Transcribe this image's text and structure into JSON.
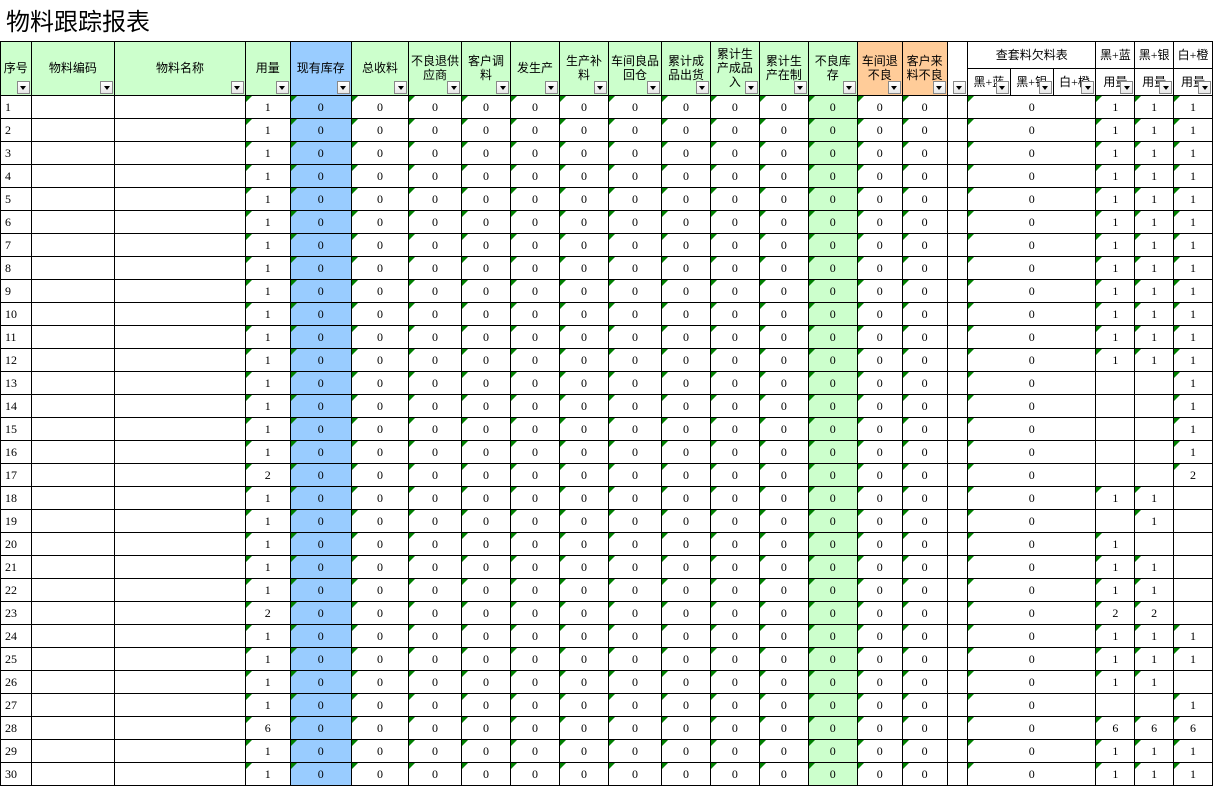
{
  "title": "物料跟踪报表",
  "headers": {
    "seq": "序号",
    "code": "物料编码",
    "name": "物料名称",
    "usage": "用量",
    "stock": "现有库存",
    "recv": "总收料",
    "defret": "不良退供应商",
    "custadj": "客户调料",
    "prod": "发生产",
    "prodsup": "生产补料",
    "wsreturn": "车间良品回仓",
    "cumout": "累计成品出货",
    "cumin": "累计生产成品入",
    "cumwip": "累计生产在制",
    "defstock": "不良库存",
    "wsdef": "车间退不良",
    "custdef": "客户来料不良",
    "gap": "",
    "kit_title": "查套料欠料表",
    "kit1": "黑+蓝",
    "kit2": "黑+银",
    "kit3": "白+橙",
    "kit4a": "黑+蓝",
    "kit4b": "用量",
    "kit5a": "黑+银",
    "kit5b": "用量",
    "kit6a": "白+橙",
    "kit6b": "用量"
  },
  "rows": [
    {
      "seq": 1,
      "usage": 1,
      "k4": 1,
      "k5": 1,
      "k6": 1
    },
    {
      "seq": 2,
      "usage": 1,
      "k4": 1,
      "k5": 1,
      "k6": 1
    },
    {
      "seq": 3,
      "usage": 1,
      "k4": 1,
      "k5": 1,
      "k6": 1
    },
    {
      "seq": 4,
      "usage": 1,
      "k4": 1,
      "k5": 1,
      "k6": 1
    },
    {
      "seq": 5,
      "usage": 1,
      "k4": 1,
      "k5": 1,
      "k6": 1
    },
    {
      "seq": 6,
      "usage": 1,
      "k4": 1,
      "k5": 1,
      "k6": 1
    },
    {
      "seq": 7,
      "usage": 1,
      "k4": 1,
      "k5": 1,
      "k6": 1
    },
    {
      "seq": 8,
      "usage": 1,
      "k4": 1,
      "k5": 1,
      "k6": 1
    },
    {
      "seq": 9,
      "usage": 1,
      "k4": 1,
      "k5": 1,
      "k6": 1
    },
    {
      "seq": 10,
      "usage": 1,
      "k4": 1,
      "k5": 1,
      "k6": 1
    },
    {
      "seq": 11,
      "usage": 1,
      "k4": 1,
      "k5": 1,
      "k6": 1
    },
    {
      "seq": 12,
      "usage": 1,
      "k4": 1,
      "k5": 1,
      "k6": 1
    },
    {
      "seq": 13,
      "usage": 1,
      "k4": "",
      "k5": "",
      "k6": 1
    },
    {
      "seq": 14,
      "usage": 1,
      "k4": "",
      "k5": "",
      "k6": 1
    },
    {
      "seq": 15,
      "usage": 1,
      "k4": "",
      "k5": "",
      "k6": 1
    },
    {
      "seq": 16,
      "usage": 1,
      "k4": "",
      "k5": "",
      "k6": 1
    },
    {
      "seq": 17,
      "usage": 2,
      "k4": "",
      "k5": "",
      "k6": 2
    },
    {
      "seq": 18,
      "usage": 1,
      "k4": 1,
      "k5": 1,
      "k6": ""
    },
    {
      "seq": 19,
      "usage": 1,
      "k4": "",
      "k5": 1,
      "k6": ""
    },
    {
      "seq": 20,
      "usage": 1,
      "k4": 1,
      "k5": "",
      "k6": ""
    },
    {
      "seq": 21,
      "usage": 1,
      "k4": 1,
      "k5": 1,
      "k6": ""
    },
    {
      "seq": 22,
      "usage": 1,
      "k4": 1,
      "k5": 1,
      "k6": ""
    },
    {
      "seq": 23,
      "usage": 2,
      "k4": 2,
      "k5": 2,
      "k6": ""
    },
    {
      "seq": 24,
      "usage": 1,
      "k4": 1,
      "k5": 1,
      "k6": 1
    },
    {
      "seq": 25,
      "usage": 1,
      "k4": 1,
      "k5": 1,
      "k6": 1
    },
    {
      "seq": 26,
      "usage": 1,
      "k4": 1,
      "k5": 1,
      "k6": ""
    },
    {
      "seq": 27,
      "usage": 1,
      "k4": "",
      "k5": "",
      "k6": 1
    },
    {
      "seq": 28,
      "usage": 6,
      "k4": 6,
      "k5": 6,
      "k6": 6
    },
    {
      "seq": 29,
      "usage": 1,
      "k4": 1,
      "k5": 1,
      "k6": 1
    },
    {
      "seq": 30,
      "usage": 1,
      "k4": 1,
      "k5": 1,
      "k6": 1
    }
  ],
  "zero": "0"
}
